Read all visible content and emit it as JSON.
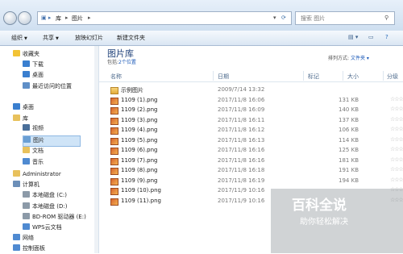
{
  "address": {
    "crumbs": [
      "库",
      "图片"
    ]
  },
  "search": {
    "placeholder": "搜索 图片"
  },
  "toolbar": {
    "organize": "组织",
    "share": "共享",
    "slideshow": "放映幻灯片",
    "new_folder": "新建文件夹"
  },
  "sidebar": {
    "items": [
      {
        "label": "收藏夹",
        "icon": "star-icon",
        "color": "#f2c335"
      },
      {
        "label": "下载",
        "icon": "download-folder-icon",
        "color": "#3a7fcf"
      },
      {
        "label": "桌面",
        "icon": "desktop-icon",
        "color": "#3a7fcf"
      },
      {
        "label": "最近访问的位置",
        "icon": "recent-places-icon",
        "color": "#5f8fc7"
      },
      {
        "label": "桌面",
        "icon": "desktop-icon",
        "color": "#3a7fcf"
      },
      {
        "label": "库",
        "icon": "library-icon",
        "color": "#e8c15c"
      },
      {
        "label": "视频",
        "icon": "video-library-icon",
        "color": "#4a6f9a"
      },
      {
        "label": "图片",
        "icon": "pictures-library-icon",
        "color": "#6a9fd4"
      },
      {
        "label": "文档",
        "icon": "documents-library-icon",
        "color": "#e8c15c"
      },
      {
        "label": "音乐",
        "icon": "music-library-icon",
        "color": "#4f8ad1"
      },
      {
        "label": "Administrator",
        "icon": "user-folder-icon",
        "color": "#e8c15c"
      },
      {
        "label": "计算机",
        "icon": "computer-icon",
        "color": "#6c8fb8"
      },
      {
        "label": "本地磁盘 (C:)",
        "icon": "drive-icon",
        "color": "#8c9aa8"
      },
      {
        "label": "本地磁盘 (D:)",
        "icon": "drive-icon",
        "color": "#8c9aa8"
      },
      {
        "label": "BD-ROM 驱动器 (E:)",
        "icon": "optical-drive-icon",
        "color": "#8c9aa8"
      },
      {
        "label": "WPS云文档",
        "icon": "cloud-drive-icon",
        "color": "#4f8ad1"
      },
      {
        "label": "网络",
        "icon": "network-icon",
        "color": "#4f8ad1"
      },
      {
        "label": "控制面板",
        "icon": "control-panel-icon",
        "color": "#4f8ad1"
      }
    ]
  },
  "library": {
    "title": "图片库",
    "includes": "包括:",
    "locations": "2个位置",
    "arrange_label": "排列方式:",
    "arrange_value": "文件夹"
  },
  "columns": {
    "name": "名称",
    "date": "日期",
    "tags": "标记",
    "size": "大小",
    "rating": "分级"
  },
  "files": [
    {
      "name": "示例图片",
      "date": "2009/7/14 13:32",
      "size": "",
      "type": "folder"
    },
    {
      "name": "1109 (1).png",
      "date": "2017/11/8 16:06",
      "size": "131 KB",
      "type": "png"
    },
    {
      "name": "1109 (2).png",
      "date": "2017/11/8 16:09",
      "size": "140 KB",
      "type": "png"
    },
    {
      "name": "1109 (3).png",
      "date": "2017/11/8 16:11",
      "size": "137 KB",
      "type": "png"
    },
    {
      "name": "1109 (4).png",
      "date": "2017/11/8 16:12",
      "size": "106 KB",
      "type": "png"
    },
    {
      "name": "1109 (5).png",
      "date": "2017/11/8 16:13",
      "size": "114 KB",
      "type": "png"
    },
    {
      "name": "1109 (6).png",
      "date": "2017/11/8 16:16",
      "size": "125 KB",
      "type": "png"
    },
    {
      "name": "1109 (7).png",
      "date": "2017/11/8 16:16",
      "size": "181 KB",
      "type": "png"
    },
    {
      "name": "1109 (8).png",
      "date": "2017/11/8 16:18",
      "size": "191 KB",
      "type": "png"
    },
    {
      "name": "1109 (9).png",
      "date": "2017/11/8 16:19",
      "size": "194 KB",
      "type": "png"
    },
    {
      "name": "1109 (10).png",
      "date": "2017/11/9 10:16",
      "size": "",
      "type": "png"
    },
    {
      "name": "1109 (11).png",
      "date": "2017/11/9 10:16",
      "size": "",
      "type": "png"
    }
  ],
  "watermark": {
    "title": "百科全说",
    "subtitle": "助你轻松解决"
  }
}
